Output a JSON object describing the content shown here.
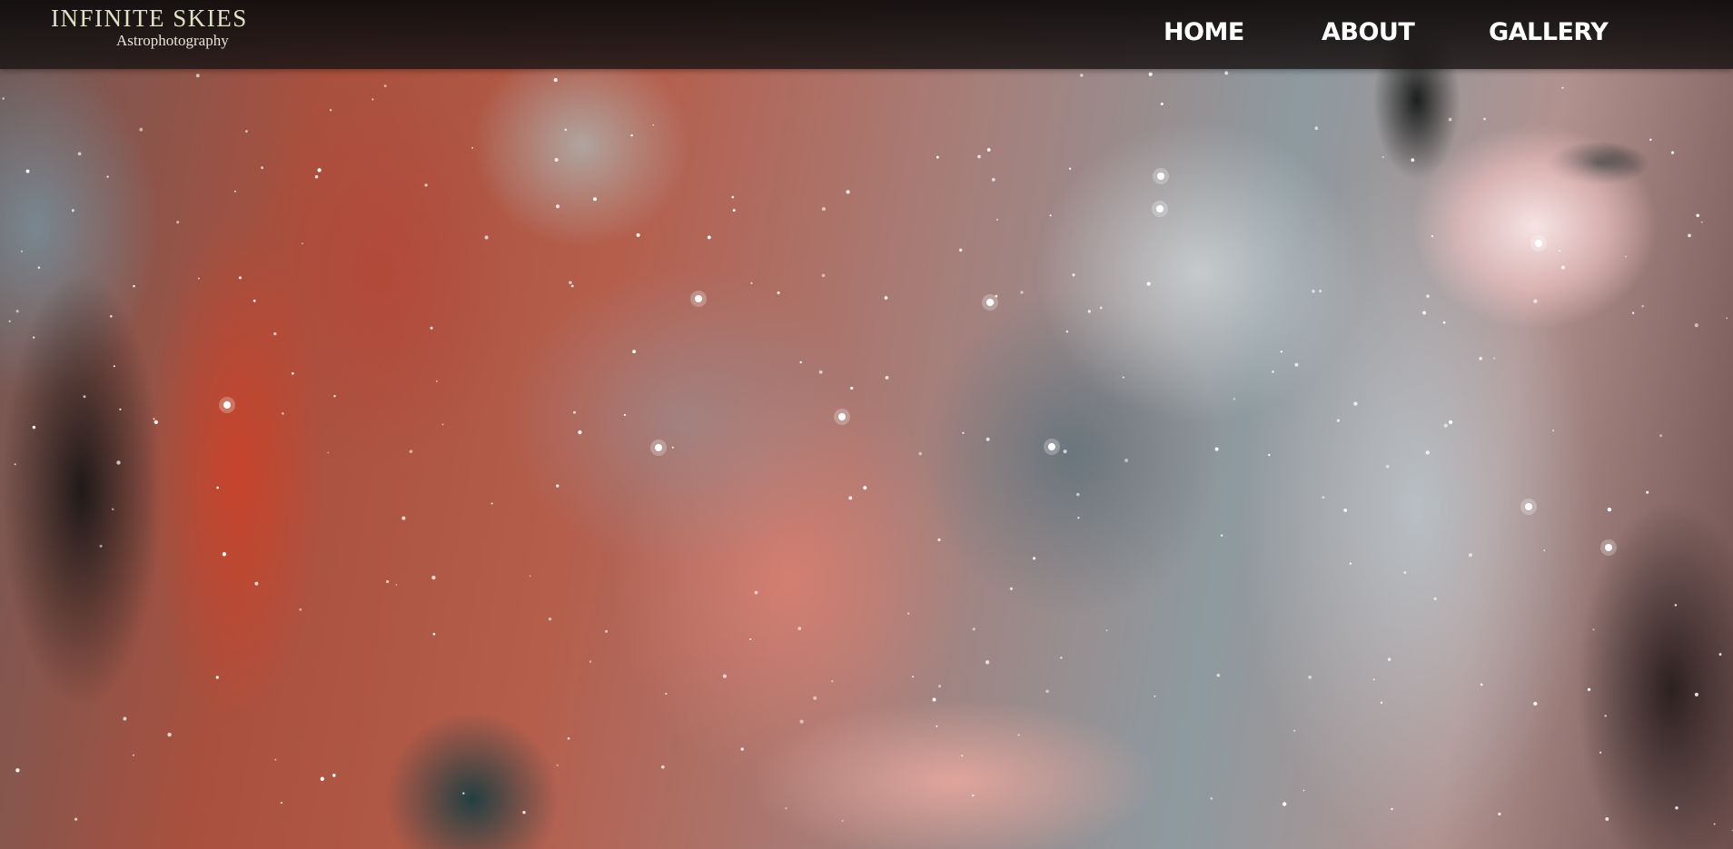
{
  "site": {
    "title": "INFINITE SKIES",
    "subtitle": "Astrophotography"
  },
  "nav": {
    "items": [
      {
        "label": "HOME"
      },
      {
        "label": "ABOUT"
      },
      {
        "label": "GALLERY"
      }
    ]
  },
  "hero": {
    "description": "nebula background image"
  },
  "colors": {
    "topbar": "#1a1414",
    "logo_title": "#dfe3c6",
    "nav_text": "#ffffff"
  }
}
